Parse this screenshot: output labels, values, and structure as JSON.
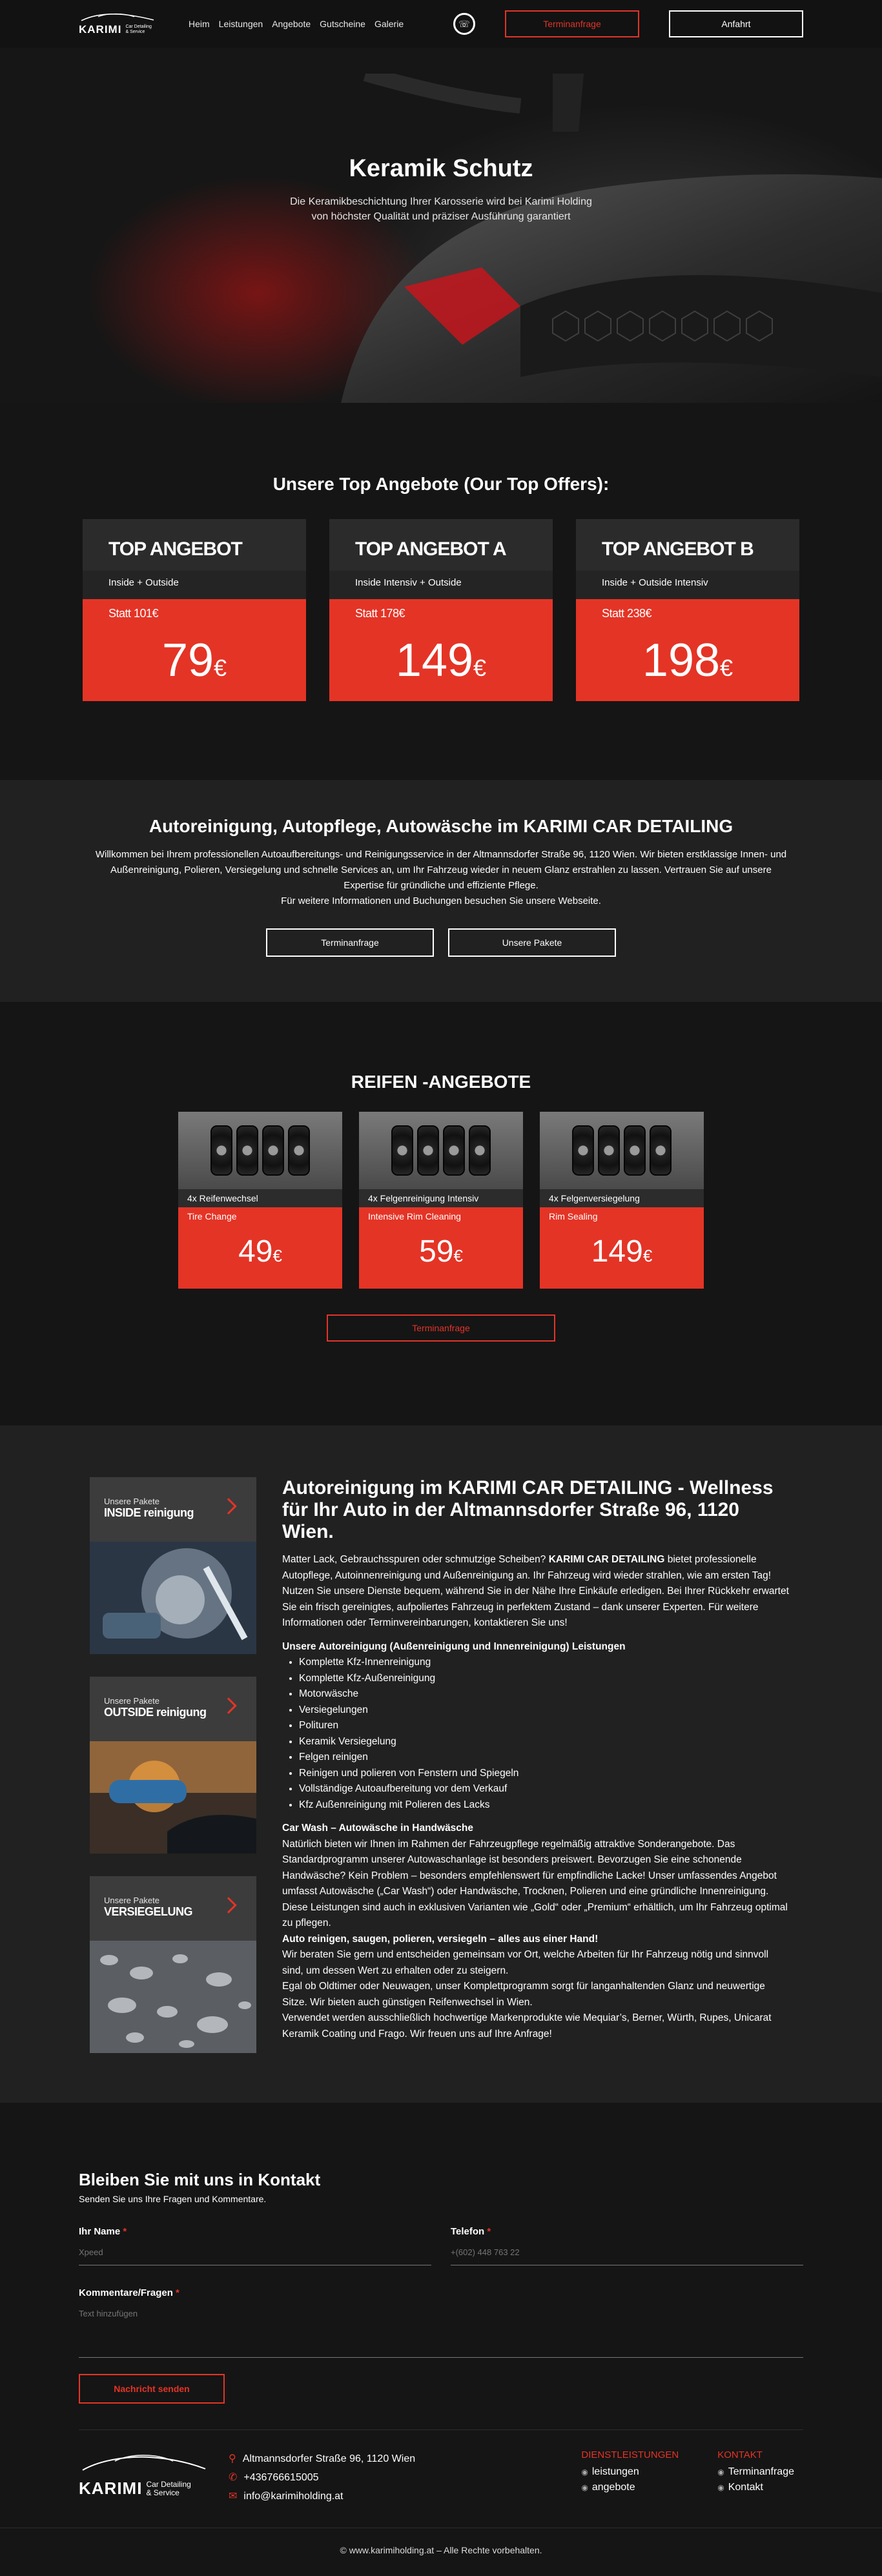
{
  "nav": {
    "logo_word": "KARIMI",
    "logo_sub": [
      "Car Detailing",
      "& Service"
    ],
    "links": [
      "Heim",
      "Leistungen",
      "Angebote",
      "Gutscheine",
      "Galerie"
    ],
    "whatsapp_icon": "whatsapp-icon",
    "btn_termin": "Terminanfrage",
    "btn_anfahrt": "Anfahrt"
  },
  "hero": {
    "title": "Keramik Schutz",
    "subtitle": "Die Keramikbeschichtung Ihrer Karosserie wird bei Karimi Holding von höchster Qualität und präziser Ausführung garantiert"
  },
  "offers": {
    "title": "Unsere Top Angebote (Our Top Offers):",
    "cards": [
      {
        "name": "TOP ANGEBOT",
        "desc": "Inside + Outside",
        "statt": "Statt 101€",
        "price": "79",
        "euro": "€"
      },
      {
        "name": "TOP ANGEBOT A",
        "desc": "Inside Intensiv + Outside",
        "statt": "Statt 178€",
        "price": "149",
        "euro": "€"
      },
      {
        "name": "TOP ANGEBOT B",
        "desc": "Inside + Outside Intensiv",
        "statt": "Statt 238€",
        "price": "198",
        "euro": "€"
      }
    ]
  },
  "info": {
    "title": "Autoreinigung, Autopflege, Autowäsche im KARIMI CAR DETAILING",
    "text": "Willkommen bei Ihrem professionellen Autoaufbereitungs- und Reinigungsservice in der Altmannsdorfer Straße 96, 1120 Wien. Wir bieten erstklassige Innen- und Außenreinigung, Polieren, Versiegelung und schnelle Services an, um Ihr Fahrzeug wieder in neuem Glanz erstrahlen zu lassen. Vertrauen Sie auf unsere Expertise für gründliche und effiziente Pflege.",
    "text2": "Für weitere Informationen und Buchungen besuchen Sie unsere Webseite.",
    "btn_termin": "Terminanfrage",
    "btn_pakete": "Unsere Pakete"
  },
  "tires": {
    "title": "REIFEN -ANGEBOTE",
    "cards": [
      {
        "de": "4x Reifenwechsel",
        "en": "Tire Change",
        "price": "49",
        "euro": "€"
      },
      {
        "de": "4x Felgenreinigung Intensiv",
        "en": "Intensive Rim Cleaning",
        "price": "59",
        "euro": "€"
      },
      {
        "de": "4x Felgenversiegelung",
        "en": "Rim Sealing",
        "price": "149",
        "euro": "€"
      }
    ],
    "btn": "Terminanfrage"
  },
  "services": {
    "cards": [
      {
        "small": "Unsere Pakete",
        "big": "INSIDE reinigung",
        "chevron_icon": "chevron-right-icon"
      },
      {
        "small": "Unsere Pakete",
        "big": "OUTSIDE reinigung",
        "chevron_icon": "chevron-right-icon"
      },
      {
        "small": "Unsere Pakete",
        "big": "VERSIEGELUNG",
        "chevron_icon": "chevron-right-icon"
      }
    ],
    "title": "Autoreinigung im KARIMI CAR DETAILING - Wellness für Ihr Auto in der Altmannsdorfer Straße 96, 1120 Wien.",
    "p1_a": "Matter Lack, Gebrauchsspuren oder schmutzige Scheiben? ",
    "p1_b": "KARIMI CAR DETAILING",
    "p1_c": " bietet professionelle Autopflege, Autoinnenreinigung und Außenreinigung an. Ihr Fahrzeug wird wieder strahlen, wie am ersten Tag!",
    "p2": "Nutzen Sie unsere Dienste bequem, während Sie in der Nähe Ihre Einkäufe erledigen. Bei Ihrer Rückkehr erwartet Sie ein frisch gereinigtes, aufpoliertes Fahrzeug in perfektem Zustand – dank unserer Experten. Für weitere Informationen oder Terminvereinbarungen, kontaktieren Sie uns!",
    "list_title": "Unsere Autoreinigung (Außenreinigung und Innenreinigung) Leistungen",
    "list": [
      "Komplette Kfz-Innenreinigung",
      "Komplette Kfz-Außenreinigung",
      "Motorwäsche",
      "Versiegelungen",
      "Polituren",
      "Keramik Versiegelung",
      "Felgen reinigen",
      "Reinigen und polieren von Fenstern und Spiegeln",
      "Vollständige Autoaufbereitung vor dem Verkauf",
      "Kfz Außenreinigung mit Polieren des Lacks"
    ],
    "wash_title": "Car Wash – Autowäsche in Handwäsche",
    "wash_text": "Natürlich bieten wir Ihnen im Rahmen der Fahrzeugpflege regelmäßig attraktive Sonderangebote. Das Standardprogramm unserer Autowaschanlage ist besonders preiswert. Bevorzugen Sie eine schonende Handwäsche? Kein Problem – besonders empfehlenswert für empfindliche Lacke! Unser umfassendes Angebot umfasst Autowäsche („Car Wash“) oder Handwäsche, Trocknen, Polieren und eine gründliche Innenreinigung. Diese Leistungen sind auch in exklusiven Varianten wie „Gold“ oder „Premium“ erhältlich, um Ihr Fahrzeug optimal zu pflegen.",
    "clean_title": "Auto reinigen, saugen, polieren, versiegeln – alles aus einer Hand!",
    "clean_text": "Wir beraten Sie gern und entscheiden gemeinsam vor Ort, welche Arbeiten für Ihr Fahrzeug nötig und sinnvoll sind, um dessen Wert zu erhalten oder zu steigern.",
    "clean_text2": "Egal ob Oldtimer oder Neuwagen, unser Komplettprogramm sorgt für langanhaltenden Glanz und neuwertige Sitze. Wir bieten auch günstigen Reifenwechsel in Wien.",
    "clean_text3": "Verwendet werden ausschließlich hochwertige Markenprodukte wie Mequiar’s, Berner, Würth, Rupes, Unicarat Keramik Coating und Frago. Wir freuen uns auf Ihre Anfrage!"
  },
  "contact": {
    "title": "Bleiben Sie mit uns in Kontakt",
    "subtitle": "Senden Sie uns Ihre Fragen und Kommentare.",
    "name_label": "Ihr Name",
    "name_placeholder": "Xpeed",
    "phone_label": "Telefon",
    "phone_placeholder": "+(602) 448 763 22",
    "comment_label": "Kommentare/Fragen",
    "comment_placeholder": "Text hinzufügen",
    "required": "*",
    "btn_send": "Nachricht senden"
  },
  "footer": {
    "logo_word": "KARIMI",
    "logo_sub": [
      "Car Detailing",
      "& Service"
    ],
    "address": "Altmannsdorfer Straße 96, 1120 Wien",
    "phone": "+436766615005",
    "email": "info@karimiholding.at",
    "col1_title": "DIENSTLEISTUNGEN",
    "col1_items": [
      "leistungen",
      "angebote"
    ],
    "col2_title": "KONTAKT",
    "col2_items": [
      "Terminanfrage",
      "Kontakt"
    ],
    "copyright": "© www.karimiholding.at – Alle Rechte vorbehalten."
  },
  "colors": {
    "accent": "#e43426",
    "bg": "#151515",
    "bg_alt": "#212121"
  }
}
